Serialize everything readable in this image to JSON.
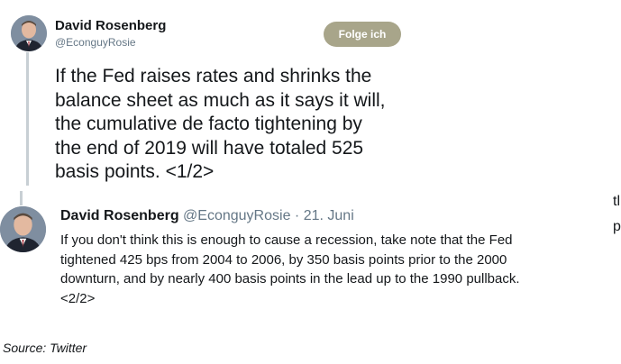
{
  "tweet1": {
    "author_name": "David Rosenberg",
    "handle": "@EconguyRosie",
    "follow_label": "Folge ich",
    "text_lines": [
      "If the Fed raises rates and shrinks the",
      "balance sheet as much as it says it will,",
      "the cumulative de facto tightening by",
      "the end of 2019 will have totaled 525",
      "basis points. <1/2>"
    ]
  },
  "tweet2": {
    "author_name": "David Rosenberg",
    "handle": "@EconguyRosie",
    "separator": "·",
    "date": "21. Juni",
    "text_lines": [
      "If you don't think this is enough to cause a recession, take note that the Fed",
      "tightened 425 bps from 2004 to 2006, by 350 basis points prior to the 2000",
      "downturn, and by nearly 400 basis points in the lead up to the 1990 pullback.",
      "<2/2>"
    ]
  },
  "edge_fragments": [
    "tl",
    "p"
  ],
  "source_caption": "Source: Twitter",
  "colors": {
    "follow_button_bg": "#a8a58a",
    "muted_text": "#657786",
    "thread_line": "#c8cfd4"
  },
  "icons": {
    "avatar": "person-portrait"
  }
}
